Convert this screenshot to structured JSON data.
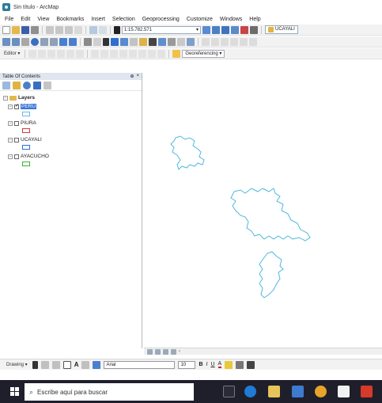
{
  "window": {
    "title": "Sin título - ArcMap"
  },
  "menu": [
    "File",
    "Edit",
    "View",
    "Bookmarks",
    "Insert",
    "Selection",
    "Geoprocessing",
    "Customize",
    "Windows",
    "Help"
  ],
  "toolbar": {
    "scale": "1:15.782.571",
    "active_layer": "UCAYALI",
    "editor": "Editor ▾",
    "georeferencing": "Georeferencing ▾"
  },
  "toc": {
    "title": "Table Of Contents",
    "close": "× ",
    "pin": "⊕",
    "group": "Layers",
    "layers": [
      {
        "name": "PERU",
        "checked": true,
        "selected": true,
        "color": "#6fb5e8"
      },
      {
        "name": "PIURA",
        "checked": false,
        "selected": false,
        "color": "#d23a3a"
      },
      {
        "name": "UCAYALI",
        "checked": false,
        "selected": false,
        "color": "#2a6fd6"
      },
      {
        "name": "AYACUCHO",
        "checked": false,
        "selected": false,
        "color": "#3bb13b"
      }
    ]
  },
  "map": {
    "outline_color": "#4fb8dd"
  },
  "drawing": {
    "label": "Drawing ▾",
    "font": "Arial",
    "size": "10"
  },
  "taskbar": {
    "search_placeholder": "Escribe aquí para buscar"
  }
}
